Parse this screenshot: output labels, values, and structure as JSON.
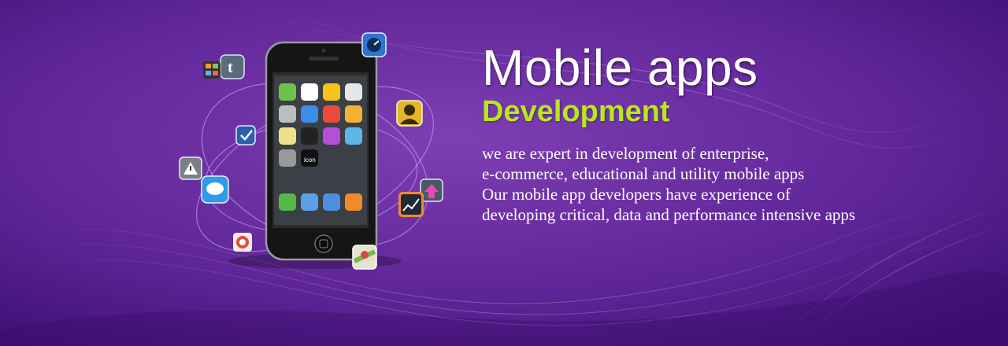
{
  "banner": {
    "title": "Mobile apps",
    "subtitle": "Development",
    "description_lines": [
      "we are expert in development of enterprise,",
      "e-commerce, educational and utility mobile apps",
      "Our mobile app developers have experience of",
      "developing critical, data and performance intensive apps"
    ],
    "phone_icon_text": "icon"
  },
  "colors": {
    "background_dark": "#4b1783",
    "background_light": "#7a3bb0",
    "title": "#ffffff",
    "subtitle": "#b9e81c",
    "description": "#ffffff"
  },
  "floating_icons": [
    "tumblr-icon",
    "app-grid-icon",
    "clock-icon",
    "todo-check-icon",
    "contact-icon",
    "warning-icon",
    "chat-bubble-icon",
    "upload-arrow-icon",
    "stock-chart-icon",
    "target-icon",
    "maps-icon"
  ]
}
